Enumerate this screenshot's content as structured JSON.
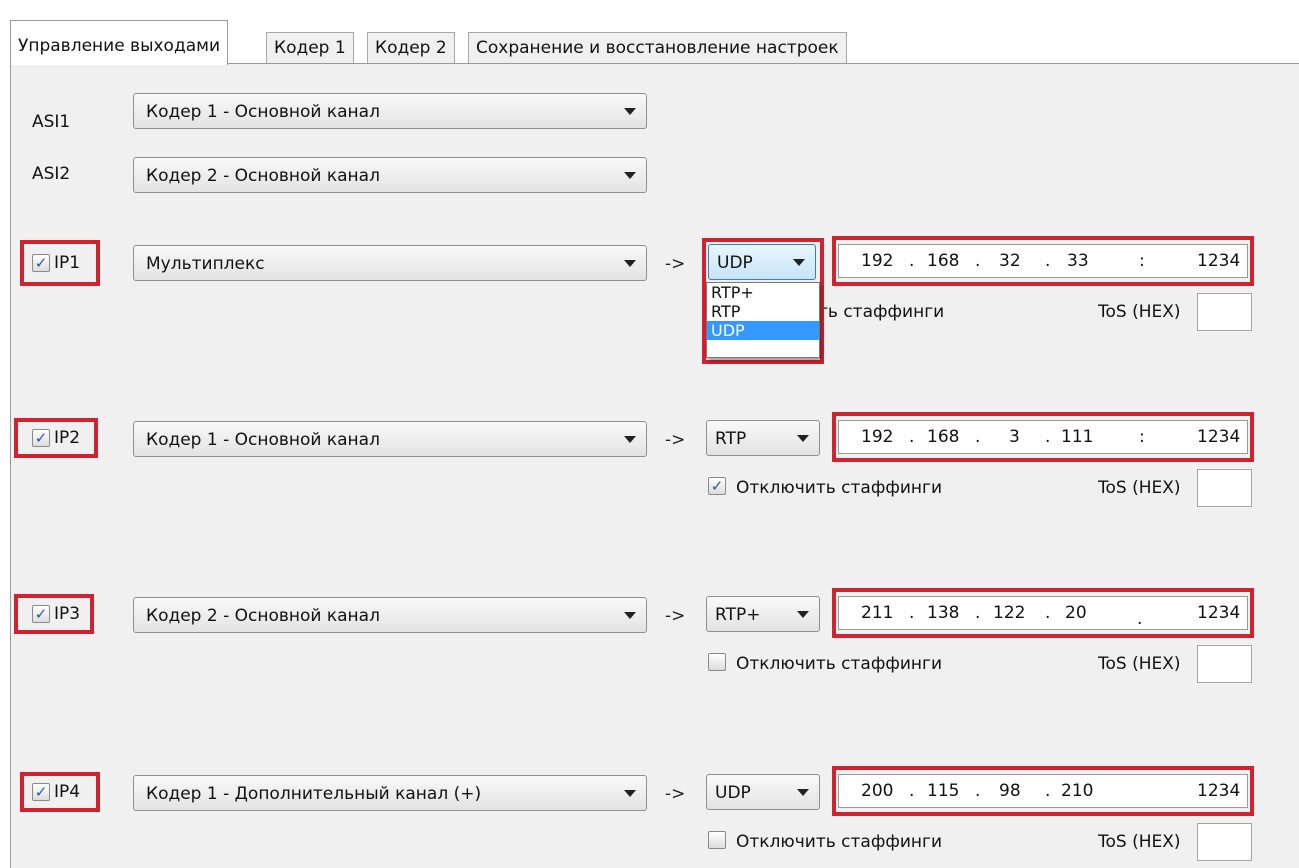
{
  "tabs": [
    "Управление выходами",
    "Кодер 1",
    "Кодер 2",
    "Сохранение и восстановление настроек"
  ],
  "asi": [
    {
      "label": "ASI1",
      "source": "Кодер 1 - Основной канал"
    },
    {
      "label": "ASI2",
      "source": "Кодер 2 - Основной канал"
    }
  ],
  "ip": [
    {
      "label": "IP1",
      "checked": true,
      "source": "Мультиплекс",
      "protocol": "UDP",
      "addr": [
        "192",
        "168",
        "32",
        "33"
      ],
      "port_sep": ":",
      "port": "1234",
      "stuffing_label": "ть стаффинги",
      "tos_label": "ToS (HEX)",
      "tos": ""
    },
    {
      "label": "IP2",
      "checked": true,
      "source": "Кодер 1 - Основной канал",
      "protocol": "RTP",
      "addr": [
        "192",
        "168",
        "3",
        "111"
      ],
      "port_sep": ":",
      "port": "1234",
      "stuffing_label": "Отключить стаффинги",
      "stuffing_checked": true,
      "tos_label": "ToS (HEX)",
      "tos": ""
    },
    {
      "label": "IP3",
      "checked": true,
      "source": "Кодер 2 - Основной канал",
      "protocol": "RTP+",
      "addr": [
        "211",
        "138",
        "122",
        "20"
      ],
      "port_sep": ".",
      "port": "1234",
      "stuffing_label": "Отключить стаффинги",
      "stuffing_checked": false,
      "tos_label": "ToS (HEX)",
      "tos": ""
    },
    {
      "label": "IP4",
      "checked": true,
      "source": "Кодер 1 - Дополнительный канал (+)",
      "protocol": "UDP",
      "addr": [
        "200",
        "115",
        "98",
        "210"
      ],
      "port_sep": "",
      "port": "1234",
      "stuffing_label": "Отключить стаффинги",
      "stuffing_checked": false,
      "tos_label": "ToS (HEX)",
      "tos": ""
    }
  ],
  "arrow": "->",
  "dot": ".",
  "check_mark": "✓",
  "protocol_options": [
    "RTP+",
    "RTP",
    "UDP"
  ],
  "protocol_selected": "UDP",
  "highlight_color": "#d0232f",
  "selection_color": "#3399ff"
}
